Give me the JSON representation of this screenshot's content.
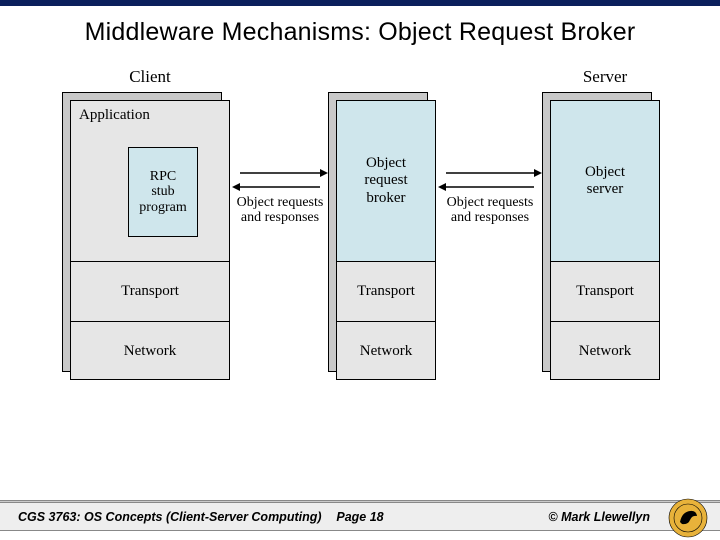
{
  "title": "Middleware Mechanisms: Object Request Broker",
  "client": {
    "title": "Client",
    "layers": {
      "app": "Application",
      "transport": "Transport",
      "network": "Network"
    },
    "rpc": "RPC\nstub\nprogram"
  },
  "middle": {
    "layers": {
      "orb": "Object\nrequest\nbroker",
      "transport": "Transport",
      "network": "Network"
    }
  },
  "server": {
    "title": "Server",
    "layers": {
      "objserver": "Object\nserver",
      "transport": "Transport",
      "network": "Network"
    }
  },
  "arrow_label": "Object requests\nand responses",
  "footer": {
    "course": "CGS 3763: OS Concepts  (Client-Server Computing)",
    "page": "Page 18",
    "copyright": "© Mark Llewellyn"
  }
}
